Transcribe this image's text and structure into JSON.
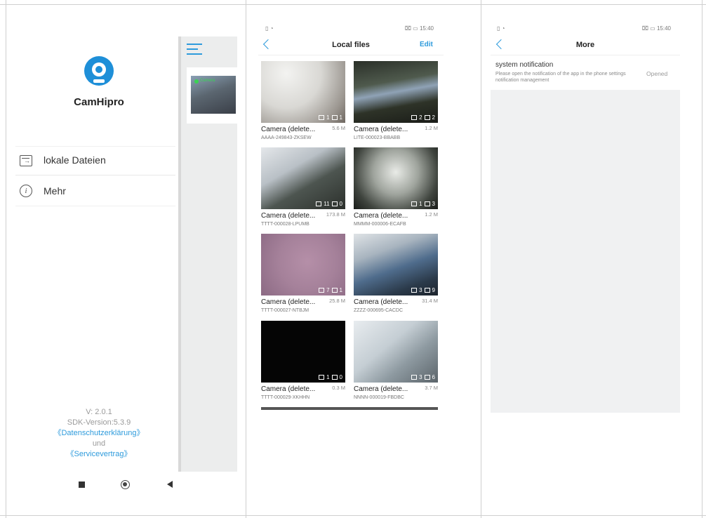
{
  "screens": {
    "drawer": {
      "app_name": "CamHipro",
      "menu": [
        {
          "label": "lokale Dateien",
          "icon": "local-files-icon"
        },
        {
          "label": "Mehr",
          "icon": "info-icon"
        }
      ],
      "preview_overlay_text": "Camera",
      "footer": {
        "version": "V: 2.0.1",
        "sdk": "SDK-Version:5.3.9",
        "privacy": "《Datenschutzerklärung》",
        "and": "und",
        "service": "《Servicevertrag》"
      }
    },
    "local_files": {
      "status_time": "15:40",
      "title": "Local files",
      "edit": "Edit",
      "tiles": [
        {
          "name": "Camera (delete...",
          "size": "5.6 M",
          "id": "AAAA-249843-ZKSEW",
          "videos": "1",
          "photos": "1"
        },
        {
          "name": "Camera (delete...",
          "size": "1.2 M",
          "id": "LITE-000023-BBABB",
          "videos": "2",
          "photos": "2"
        },
        {
          "name": "Camera (delete...",
          "size": "173.8 M",
          "id": "TTTT-000028-LPUMB",
          "videos": "11",
          "photos": "0"
        },
        {
          "name": "Camera (delete...",
          "size": "1.2 M",
          "id": "MMMM-000006-ECAFB",
          "videos": "1",
          "photos": "3"
        },
        {
          "name": "Camera (delete...",
          "size": "25.8 M",
          "id": "TTTT-000027-NTBJM",
          "videos": "7",
          "photos": "1"
        },
        {
          "name": "Camera (delete...",
          "size": "31.4 M",
          "id": "ZZZZ-000695-CACDC",
          "videos": "3",
          "photos": "9"
        },
        {
          "name": "Camera (delete...",
          "size": "0.3 M",
          "id": "TTTT-000029-XKHHN",
          "videos": "1",
          "photos": "0"
        },
        {
          "name": "Camera (delete...",
          "size": "3.7 M",
          "id": "NNNN-000019-FBDBC",
          "videos": "3",
          "photos": "6"
        }
      ]
    },
    "more": {
      "status_time": "15:40",
      "title": "More",
      "notification_title": "system notification",
      "notification_desc": "Please open the notification of the app in the phone settings notification management",
      "notification_state": "Opened"
    }
  },
  "colors": {
    "accent": "#2e9bdc",
    "background_gray": "#f0f1f2"
  }
}
